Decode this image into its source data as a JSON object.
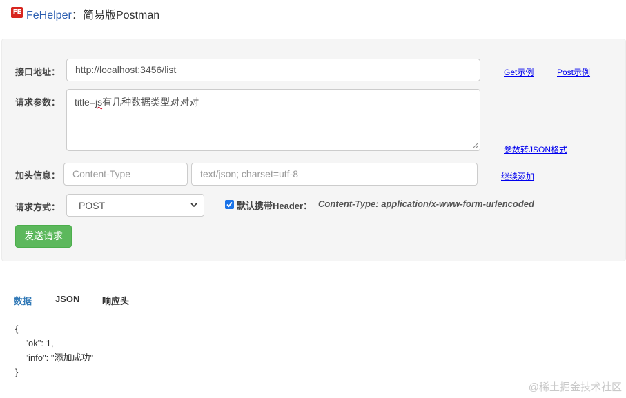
{
  "header": {
    "brand": "FeHelper",
    "separator": "：",
    "title": "简易版Postman",
    "logo_text": "FE"
  },
  "form": {
    "url_label": "接口地址：",
    "url_value": "http://localhost:3456/list",
    "get_example_link": "Get示例",
    "post_example_link": "Post示例",
    "params_label": "请求参数：",
    "params_value_before": "title=",
    "params_value_marked": "js",
    "params_value_after": "有几种数据类型对对对",
    "params_to_json_link": "参数转JSON格式",
    "header_label": "加头信息：",
    "header_key_placeholder": "Content-Type",
    "header_value_placeholder": "text/json; charset=utf-8",
    "add_header_link": "继续添加",
    "method_label": "请求方式：",
    "method_value": "POST",
    "default_header_checked": true,
    "default_header_label": "默认携带Header：",
    "default_header_value": "Content-Type: application/x-www-form-urlencoded",
    "send_button": "发送请求"
  },
  "tabs": [
    {
      "label": "数据",
      "active": true
    },
    {
      "label": "JSON",
      "active": false
    },
    {
      "label": "响应头",
      "active": false
    }
  ],
  "response": {
    "line1": "{",
    "line2": "    \"ok\": 1,",
    "line3": "    \"info\": \"添加成功\"",
    "line4": "}"
  },
  "watermark": "@稀土掘金技术社区",
  "colors": {
    "brand": "#2a5db0",
    "send_button": "#5cb85c",
    "active_tab": "#337ab7",
    "checkbox": "#1a73e8"
  }
}
